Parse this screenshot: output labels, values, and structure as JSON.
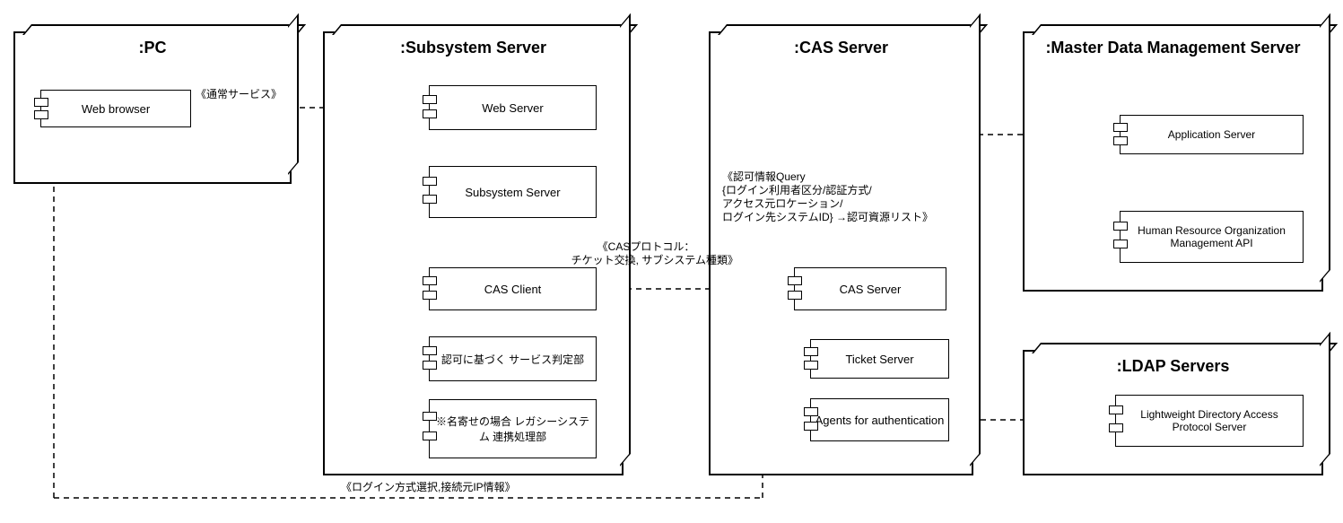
{
  "diagram": {
    "nodes": {
      "pc": {
        "title": ":PC"
      },
      "sub": {
        "title": ":Subsystem Server"
      },
      "cas": {
        "title": ":CAS Server"
      },
      "mdm": {
        "title": ":Master Data\nManagement Server"
      },
      "ldap": {
        "title": ":LDAP Servers"
      }
    },
    "components": {
      "browser": {
        "label": "Web browser"
      },
      "webserver": {
        "label": "Web Server"
      },
      "subsrv": {
        "label": "Subsystem\nServer"
      },
      "casclient": {
        "label": "CAS Client"
      },
      "authsvc": {
        "label": "認可に基づく\nサービス判定部"
      },
      "legacy": {
        "label": "※名寄せの場合\nレガシーシステム\n連携処理部"
      },
      "cassrv": {
        "label": "CAS  Server"
      },
      "ticket": {
        "label": "Ticket  Server"
      },
      "agents": {
        "label": "Agents for\nauthentication"
      },
      "appsrv": {
        "label": "Application Server"
      },
      "hrapi": {
        "label": "Human Resource\nOrganization\nManagement API"
      },
      "ldapsrv": {
        "label": "Lightweight Directory\nAccess Protocol\nServer"
      }
    },
    "labels": {
      "l_normal": "《通常サービス》",
      "l_casprot": "《CASプロトコル：\n  チケット交換, サブシステム種類》",
      "l_login": "《ログイン方式選択,接続元IP情報》",
      "l_auth": "《認可情報Query\n{ログイン利用者区分/認証方式/\nアクセス元ロケーション/\nログイン先システムID} →認可資源リスト》"
    }
  }
}
